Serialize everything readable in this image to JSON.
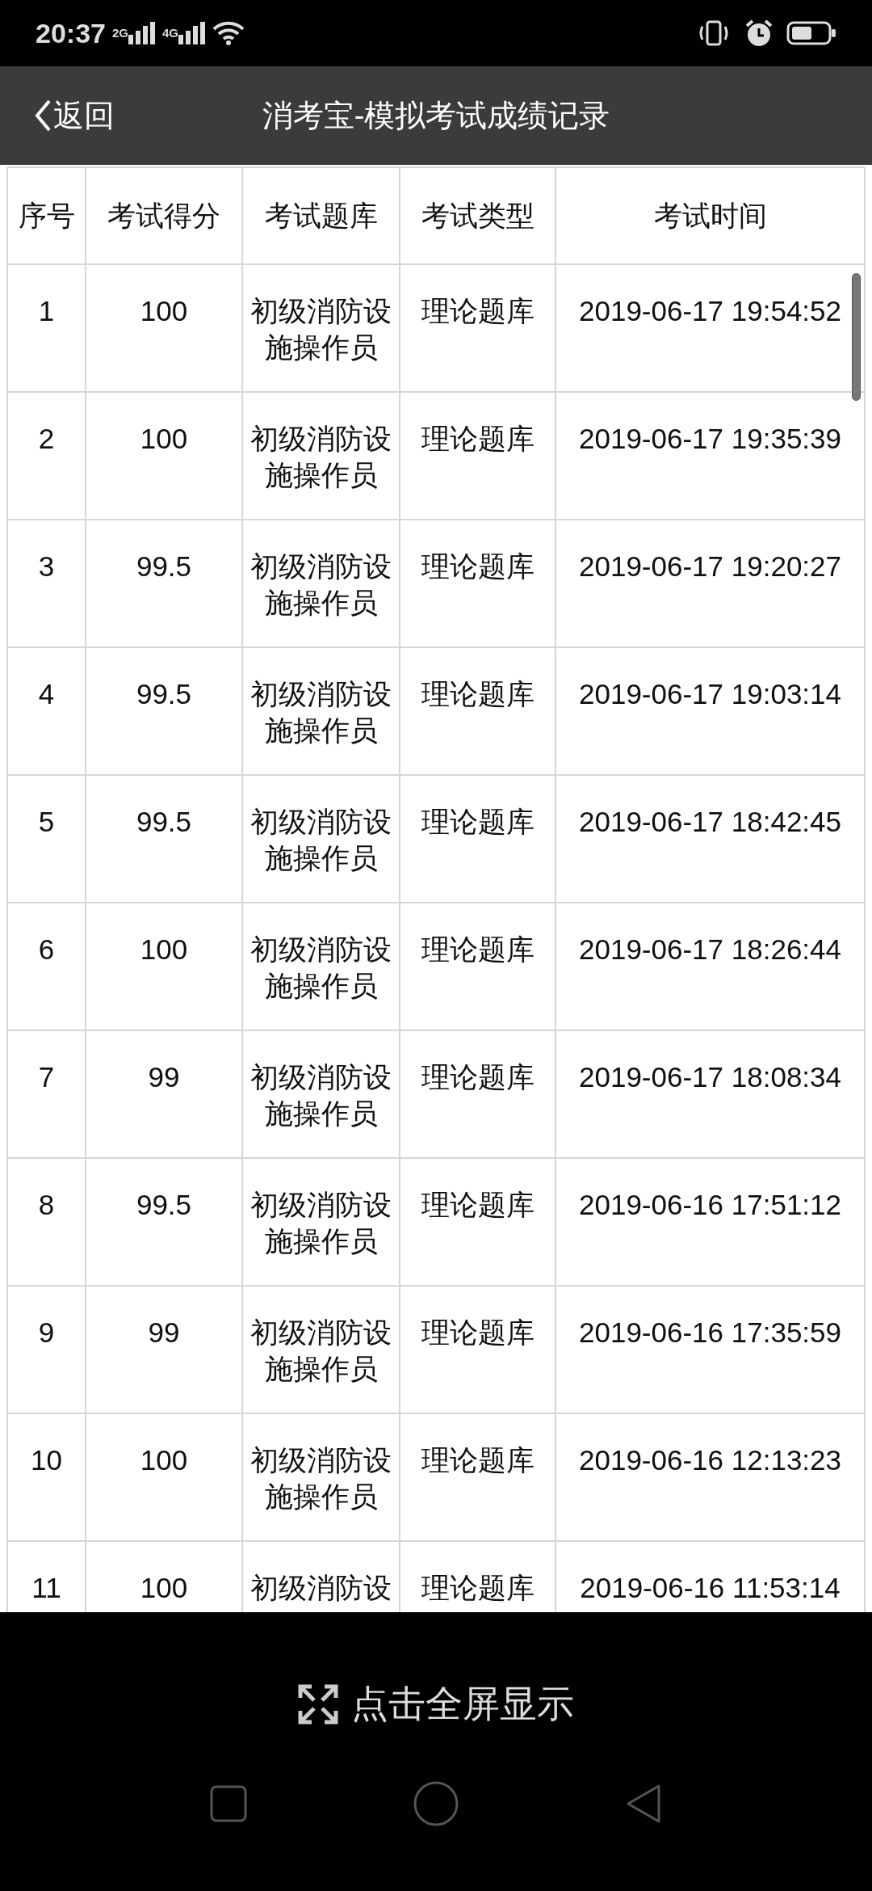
{
  "status_bar": {
    "time": "20:37",
    "signals": [
      {
        "label": "2G"
      },
      {
        "label": "4G"
      }
    ]
  },
  "header": {
    "back": "返回",
    "title": "消考宝-模拟考试成绩记录"
  },
  "table": {
    "columns": [
      "序号",
      "考试得分",
      "考试题库",
      "考试类型",
      "考试时间"
    ],
    "rows": [
      {
        "cells": [
          "1",
          "100",
          "初级消防设施操作员",
          "理论题库",
          "2019-06-17 19:54:52"
        ]
      },
      {
        "cells": [
          "2",
          "100",
          "初级消防设施操作员",
          "理论题库",
          "2019-06-17 19:35:39"
        ]
      },
      {
        "cells": [
          "3",
          "99.5",
          "初级消防设施操作员",
          "理论题库",
          "2019-06-17 19:20:27"
        ]
      },
      {
        "cells": [
          "4",
          "99.5",
          "初级消防设施操作员",
          "理论题库",
          "2019-06-17 19:03:14"
        ]
      },
      {
        "cells": [
          "5",
          "99.5",
          "初级消防设施操作员",
          "理论题库",
          "2019-06-17 18:42:45"
        ]
      },
      {
        "cells": [
          "6",
          "100",
          "初级消防设施操作员",
          "理论题库",
          "2019-06-17 18:26:44"
        ]
      },
      {
        "cells": [
          "7",
          "99",
          "初级消防设施操作员",
          "理论题库",
          "2019-06-17 18:08:34"
        ]
      },
      {
        "cells": [
          "8",
          "99.5",
          "初级消防设施操作员",
          "理论题库",
          "2019-06-16 17:51:12"
        ]
      },
      {
        "cells": [
          "9",
          "99",
          "初级消防设施操作员",
          "理论题库",
          "2019-06-16 17:35:59"
        ]
      },
      {
        "cells": [
          "10",
          "100",
          "初级消防设施操作员",
          "理论题库",
          "2019-06-16 12:13:23"
        ]
      },
      {
        "cells": [
          "11",
          "100",
          "初级消防设",
          "理论题库",
          "2019-06-16 11:53:14"
        ]
      }
    ]
  },
  "fullscreen_button": {
    "label": "点击全屏显示"
  }
}
